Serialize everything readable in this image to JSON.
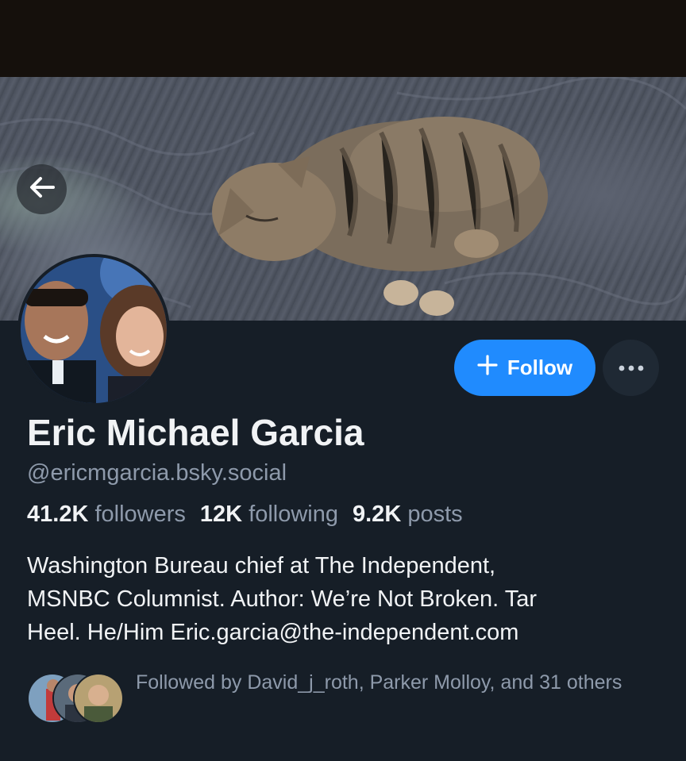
{
  "banner": {
    "description_icon": "banner-cat-photo"
  },
  "profile": {
    "display_name": "Eric Michael Garcia",
    "handle": "@ericmgarcia.bsky.social",
    "followers_count": "41.2K",
    "followers_label": "followers",
    "following_count": "12K",
    "following_label": "following",
    "posts_count": "9.2K",
    "posts_label": "posts",
    "bio": "Washington Bureau chief at The Independent,\nMSNBC Columnist. Author: We’re Not Broken. Tar\nHeel. He/Him Eric.garcia@the-independent.com"
  },
  "actions": {
    "follow_label": "Follow",
    "follow_icon": "plus-icon",
    "more_icon": "ellipsis-icon",
    "back_icon": "arrow-left-icon"
  },
  "followed_by": {
    "text": "Followed by David_j_roth, Parker Molloy, and 31 others"
  },
  "colors": {
    "background": "#161e27",
    "accent": "#208bfe",
    "muted_text": "#8e9aab",
    "primary_text": "#f1f3f5"
  }
}
